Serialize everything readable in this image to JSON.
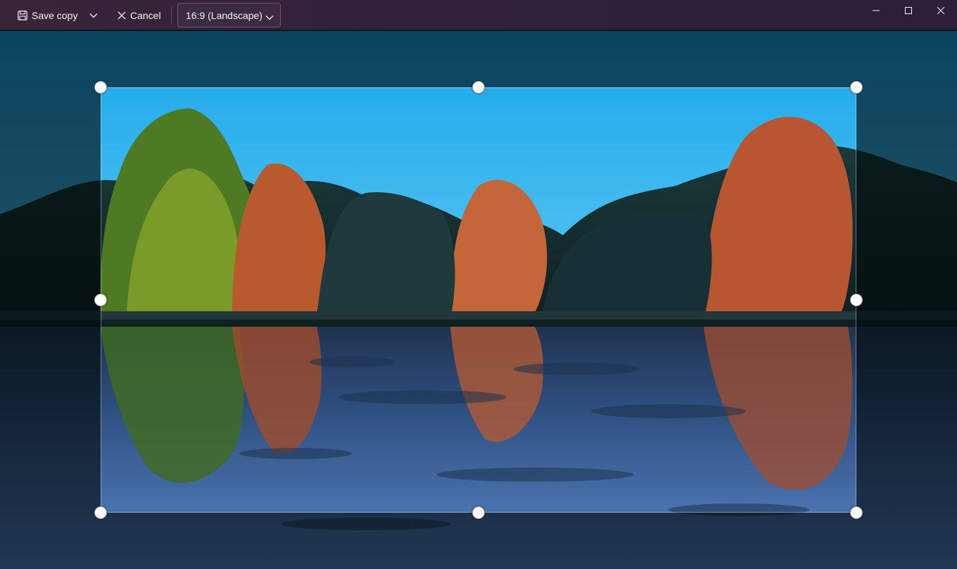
{
  "toolbar": {
    "save_label": "Save copy",
    "cancel_label": "Cancel",
    "aspect_ratio_selected": "16:9 (Landscape)"
  },
  "icons": {
    "save": "save-icon",
    "save_more": "chevron-down-icon",
    "cancel": "close-icon",
    "ratio_dropdown": "chevron-down-icon",
    "minimize": "minimize-icon",
    "maximize": "maximize-icon",
    "close": "close-icon"
  },
  "colors": {
    "titlebar": "#30203d",
    "sky": "#2fb3ec",
    "water": "#3e67a6"
  }
}
